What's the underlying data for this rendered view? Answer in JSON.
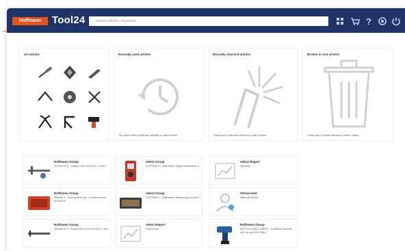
{
  "colors": {
    "topbar": "#1f3466",
    "brand": "#e2531a"
  },
  "header": {
    "logo_text": "Hoffmann",
    "app_name": "Tool24",
    "search_placeholder": "Search articles / keywords",
    "icons": [
      "grid-icon",
      "cart-icon",
      "help-icon",
      "settings-icon",
      "power-icon"
    ]
  },
  "tiles": [
    {
      "title": "All articles",
      "footer": ""
    },
    {
      "title": "Recently used articles",
      "footer": "You have hired 5 different articles in total 5 items"
    },
    {
      "title": "Recently returned articles",
      "footer": "These are 6 returned articles in total 6 items"
    },
    {
      "title": "Broken or lost articles",
      "footer": "These are 0 broken articles in total 0 items"
    }
  ],
  "cards": [
    {
      "title": "Hoffmann Group",
      "desc": "112480 M 8 - Caliper with HSS 6.4 x 4 mm"
    },
    {
      "title": "select Group",
      "desc": "SYSTEM 5 - Calibration Digital multimeter 6"
    },
    {
      "title": "select Report",
      "desc": "Quantity"
    },
    {
      "title": "Hoffmann Group",
      "desc": "986002 4 - Screwdriver set, 16-piece Nose mount EX"
    },
    {
      "title": "select Group",
      "desc": "SYSTEM 2 - Calibration Measuring tool set 2"
    },
    {
      "title": "Virtual User",
      "desc": "Hamzah Sohle"
    },
    {
      "title": "Hoffmann Group",
      "desc": "112480 M 7 - Mack with HSS 5 M 6.5 L7 mm"
    },
    {
      "title": "select Report",
      "desc": "Return fee"
    },
    {
      "title": "Hoffmann Group",
      "desc": "ATP CB 5 MAX 18RED - Cordless hammer drill 18 volt SDS MAX"
    }
  ]
}
